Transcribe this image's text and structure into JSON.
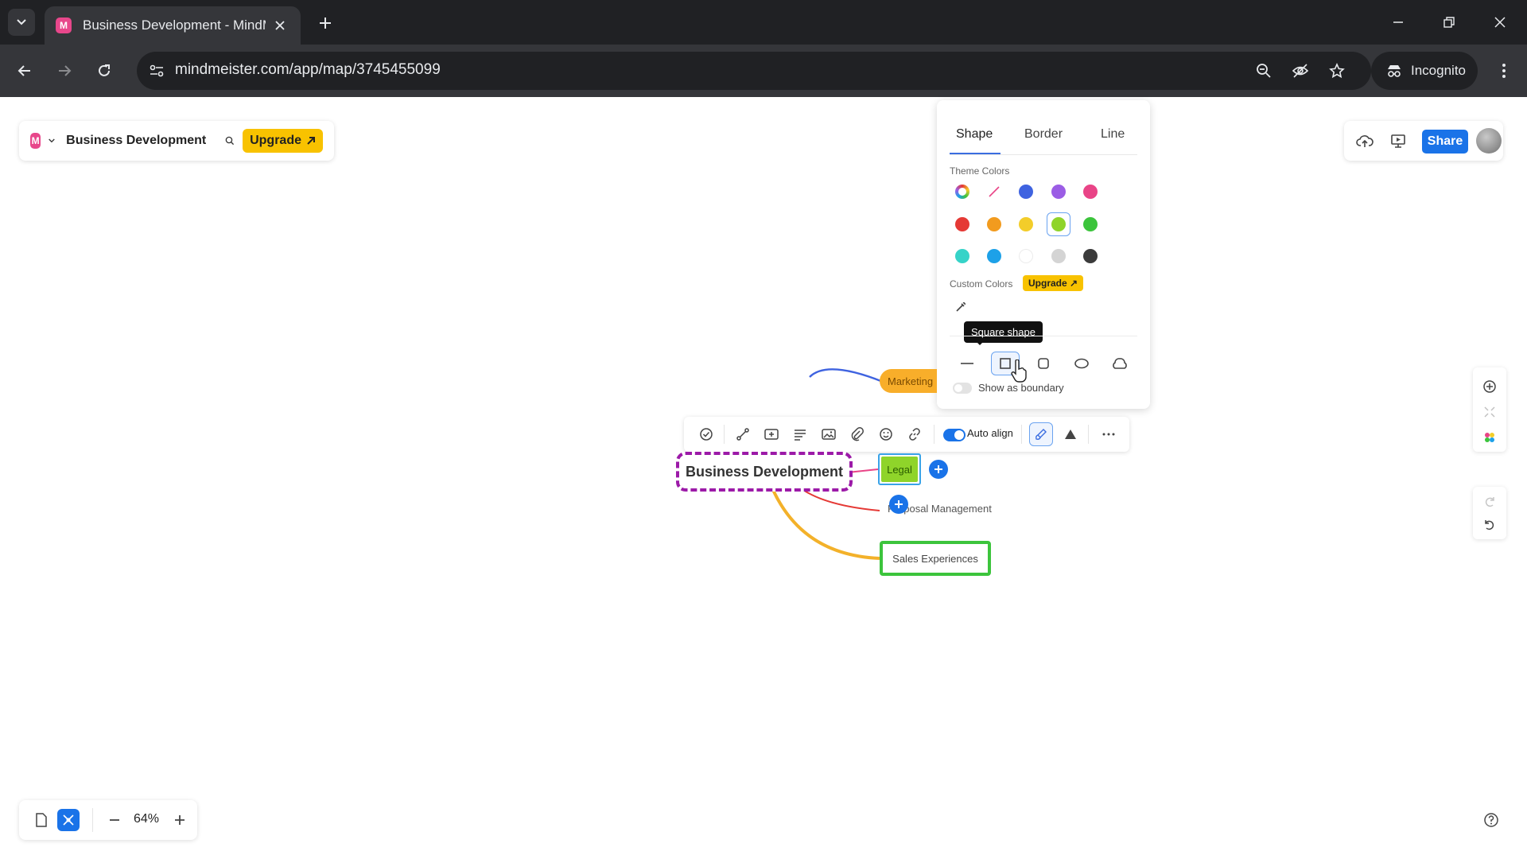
{
  "browser": {
    "tab_title": "Business Development - MindMeister",
    "url": "mindmeister.com/app/map/3745455099",
    "incognito_label": "Incognito"
  },
  "app": {
    "map_title": "Business Development",
    "upgrade_label": "Upgrade",
    "share_label": "Share"
  },
  "style_panel": {
    "tabs": [
      "Shape",
      "Border",
      "Line"
    ],
    "active_tab": "Shape",
    "theme_colors_label": "Theme Colors",
    "custom_colors_label": "Custom Colors",
    "custom_upgrade_label": "Upgrade",
    "tooltip": "Square shape",
    "show_boundary_label": "Show as boundary",
    "theme_colors": [
      "rainbow",
      "none",
      "#3f63e0",
      "#9b5de5",
      "#e94487",
      "#e53935",
      "#f29b1e",
      "#f3cd2a",
      "#8fd42a",
      "#3cc43c",
      "#36d3c8",
      "#1da1e8",
      "#ffffff",
      "#d4d4d4",
      "#3b3b3b"
    ],
    "selected_color": "#8fd42a",
    "shapes": [
      "line",
      "square",
      "rounded",
      "oval",
      "cloud"
    ],
    "selected_shape": "square"
  },
  "node_toolbar": {
    "auto_align_label": "Auto align"
  },
  "map": {
    "root": "Business Development",
    "legal": "Legal",
    "marketing": "Marketing",
    "proposal": "Proposal Management",
    "sales": "Sales Experiences"
  },
  "zoom": {
    "value": "64%"
  }
}
